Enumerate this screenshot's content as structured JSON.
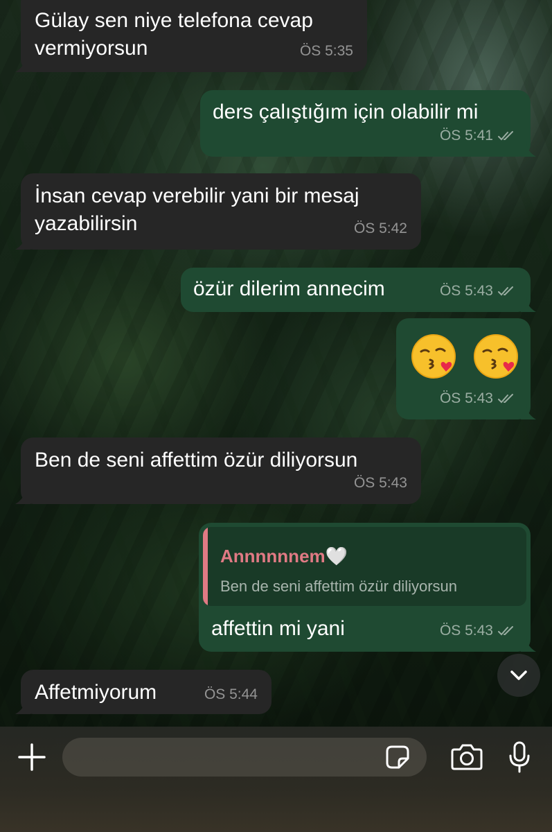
{
  "messages": [
    {
      "direction": "incoming",
      "lines": [
        "Gülay sen niye telefona cevap",
        "vermiyorsun"
      ],
      "time": "ÖS 5:35"
    },
    {
      "direction": "outgoing",
      "lines": [
        "ders çalıştığım için olabilir mi"
      ],
      "time": "ÖS 5:41",
      "status": "read"
    },
    {
      "direction": "incoming",
      "lines": [
        "İnsan cevap verebilir yani bir mesaj",
        "yazabilirsin"
      ],
      "time": "ÖS 5:42"
    },
    {
      "direction": "outgoing",
      "lines": [
        "özür dilerim annecim"
      ],
      "time": "ÖS 5:43",
      "status": "read"
    },
    {
      "direction": "outgoing",
      "emoji": [
        "kissing-face-with-heart",
        "kissing-face-with-heart"
      ],
      "time": "ÖS 5:43",
      "status": "read"
    },
    {
      "direction": "incoming",
      "lines": [
        "Ben de seni affettim özür diliyorsun"
      ],
      "time": "ÖS 5:43"
    },
    {
      "direction": "outgoing",
      "reply_to": {
        "name": "Annnnnnem🤍",
        "text": "Ben de seni affettim özür diliyorsun",
        "accent": "#e07a84"
      },
      "lines": [
        "affettin mi yani"
      ],
      "time": "ÖS 5:43",
      "status": "read"
    },
    {
      "direction": "incoming",
      "lines": [
        "Affetmiyorum"
      ],
      "time": "ÖS 5:44"
    }
  ],
  "composer": {
    "placeholder": "",
    "icons": [
      "plus-icon",
      "sticker-icon",
      "camera-icon",
      "microphone-icon"
    ]
  },
  "scroll_button": {
    "icon": "chevron-down-icon"
  },
  "colors": {
    "incoming_bubble": "#262626",
    "outgoing_bubble": "#1f4a32",
    "quote_accent": "#e07a84",
    "timestamp": "#9a9a9a"
  }
}
